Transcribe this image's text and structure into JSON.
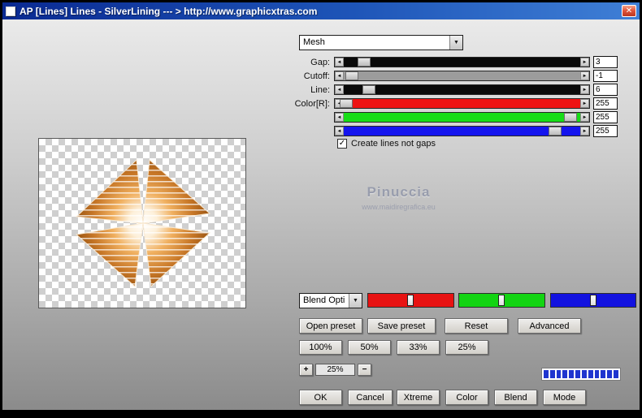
{
  "window": {
    "title": "AP [Lines]  Lines - SilverLining  --- > http://www.graphicxtras.com",
    "close_glyph": "✕"
  },
  "icons": {
    "dropdown_arrow": "▼",
    "arrow_left": "◄",
    "arrow_right": "►"
  },
  "controls": {
    "mesh_dropdown_value": "Mesh",
    "blend_dropdown_value": "Blend Opti",
    "checkbox_label": "Create lines not gaps",
    "checkbox_checked": true,
    "checkbox_glyph": "✓"
  },
  "sliders": [
    {
      "label": "Gap:",
      "value": "3",
      "track": "#0a0a0a",
      "thumb_pct": 9
    },
    {
      "label": "Cutoff:",
      "value": "-1",
      "track": "#9c9c9c",
      "thumb_pct": 4
    },
    {
      "label": "Line:",
      "value": "6",
      "track": "#0a0a0a",
      "thumb_pct": 11
    },
    {
      "label": "Color[R]:",
      "value": "255",
      "track": "#ee1313",
      "thumb_pct": 2
    },
    {
      "label": "",
      "value": "255",
      "track": "#17dd17",
      "thumb_pct": 90
    },
    {
      "label": "",
      "value": "255",
      "track": "#1414ee",
      "thumb_pct": 84
    }
  ],
  "watermark": {
    "name": "Pinuccia",
    "site": "www.maidiregrafica.eu"
  },
  "color_mixers": [
    {
      "name": "red",
      "color": "#e81212",
      "thumb_pct": 46
    },
    {
      "name": "green",
      "color": "#12d412",
      "thumb_pct": 46
    },
    {
      "name": "blue",
      "color": "#1212e0",
      "thumb_pct": 46
    }
  ],
  "buttons": {
    "presets": [
      "Open preset",
      "Save preset",
      "Reset",
      "Advanced"
    ],
    "zoom_presets": [
      "100%",
      "50%",
      "33%",
      "25%"
    ],
    "zoom_plus": "+",
    "zoom_value": "25%",
    "zoom_minus": "−",
    "actions": [
      "OK",
      "Cancel",
      "Xtreme",
      "Color",
      "Blend",
      "Mode"
    ]
  },
  "progress": {
    "segments": 12,
    "color": "#1f35cf"
  }
}
